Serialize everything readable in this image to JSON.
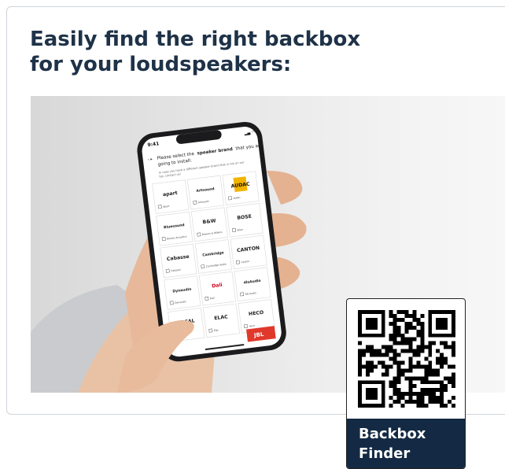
{
  "headline": {
    "line1": "Easily find the right backbox",
    "line2": "for your loudspeakers:"
  },
  "phone_screen": {
    "time": "9:41",
    "question_part1": "Please select the",
    "question_bold": "speaker brand",
    "question_part2": "that you are",
    "question_line2": "going to install:",
    "hint_line1": "In case you have a different speaker brand that is not on our",
    "hint_line2": "list, contact us!",
    "brands": [
      {
        "logo": "apart",
        "name": "Apart"
      },
      {
        "logo": "Artsound",
        "name": "Artsound"
      },
      {
        "logo": "AUDAC",
        "name": "Audac"
      },
      {
        "logo": "Bluesound",
        "name": "Boston Acoustics"
      },
      {
        "logo": "B&W",
        "name": "Bowers & Wilkins"
      },
      {
        "logo": "BOSE",
        "name": "Bose"
      },
      {
        "logo": "Cabasse",
        "name": "Cabasse"
      },
      {
        "logo": "Cambridge",
        "name": "Cambridge Audio"
      },
      {
        "logo": "CANTON",
        "name": "Canton"
      },
      {
        "logo": "Dynaudio",
        "name": "Dynaudio"
      },
      {
        "logo": "Dali",
        "name": "Dali"
      },
      {
        "logo": "dlsAudio",
        "name": "Dls Audio"
      },
      {
        "logo": "FOCAL",
        "name": "Focal"
      },
      {
        "logo": "ELAC",
        "name": "Elac"
      },
      {
        "logo": "HECO",
        "name": "Heco"
      }
    ],
    "next_logo": "JBL"
  },
  "qr": {
    "label_line1": "Backbox",
    "label_line2": "Finder"
  },
  "colors": {
    "headline": "#1e3248",
    "qr_label_bg": "#142a44",
    "audac_gold": "#f2b400",
    "jbl_red": "#e0382b",
    "dali_red": "#d0021b"
  }
}
